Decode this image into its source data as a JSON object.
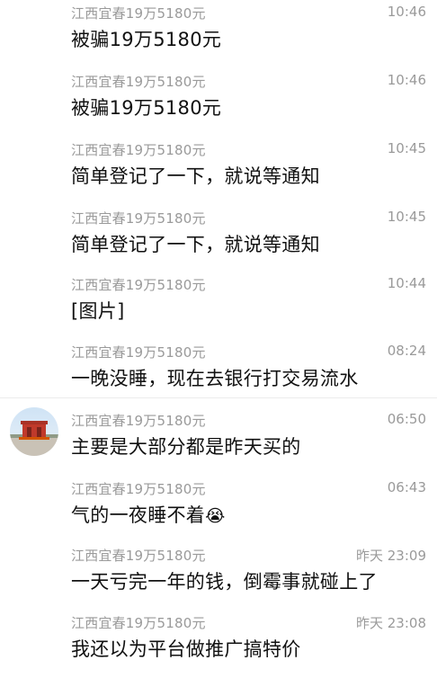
{
  "sender": "江西宜春19万5180元",
  "messages": [
    {
      "time": "10:46",
      "text": "被骗19万5180元"
    },
    {
      "time": "10:46",
      "text": "被骗19万5180元"
    },
    {
      "time": "10:45",
      "text": "简单登记了一下，就说等通知"
    },
    {
      "time": "10:45",
      "text": "简单登记了一下，就说等通知"
    },
    {
      "time": "10:44",
      "text": "[图片]"
    },
    {
      "time": "08:24",
      "text": "一晚没睡，现在去银行打交易流水"
    },
    {
      "time": "06:50",
      "text": "主要是大部分都是昨天买的"
    },
    {
      "time": "06:43",
      "text": "气的一夜睡不着",
      "emoji": "😭"
    },
    {
      "time": "昨天 23:09",
      "text": "一天亏完一年的钱，倒霉事就碰上了"
    },
    {
      "time": "昨天 23:08",
      "text": "我还以为平台做推广搞特价"
    }
  ]
}
